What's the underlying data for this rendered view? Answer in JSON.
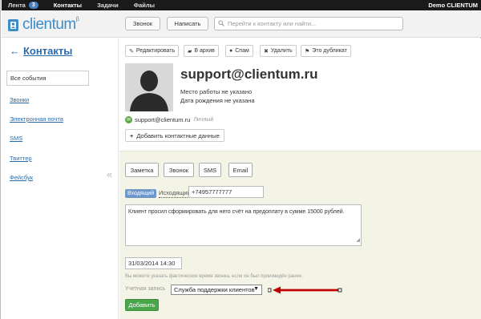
{
  "topbar": {
    "nav": [
      {
        "label": "Лента",
        "badge": "3"
      },
      {
        "label": "Контакты"
      },
      {
        "label": "Задачи"
      },
      {
        "label": "Файлы"
      }
    ],
    "account": "Demo CLIENTUM"
  },
  "header": {
    "logo_text": "clientum",
    "logo_beta": "β",
    "call_button": "Звонок",
    "write_button": "Написать",
    "search_placeholder": "Перейти к контакту или найти..."
  },
  "sidebar": {
    "back_arrow": "←",
    "title": "Контакты",
    "all_events": "Все события",
    "links": [
      "Звонки",
      "Электронная почта",
      "SMS",
      "Твиттер",
      "Фейсбук"
    ]
  },
  "gutter": {
    "collapse": "«"
  },
  "toolbar": {
    "edit": "Редактировать",
    "archive": "В архив",
    "spam": "Спам",
    "delete": "Удалить",
    "duplicate": "Это дубликат"
  },
  "contact": {
    "name": "support@clientum.ru",
    "workplace": "Место работы не указано",
    "birthday": "Дата рождения не указана",
    "email": "support@clientum.ru",
    "email_type": "Личный",
    "add_contact_data": "Добавить контактные данные"
  },
  "activity": {
    "types": [
      "Заметка",
      "Звонок",
      "SMS",
      "Email"
    ],
    "direction_in": "Входящий",
    "direction_out": "Исходящий",
    "phone": "+74957777777",
    "note_text": "Клиент просил сформировать для него счёт на предоплату в сумме 15000 рублей.",
    "datetime": "31/03/2014 14:30",
    "hint": "Вы можете указать фактическое время звонка, если он был произведён ранее.",
    "account_label": "Учетная запись",
    "account_value": "Служба поддержки клиентов",
    "submit": "Добавить"
  },
  "colors": {
    "link": "#2a6aa8",
    "brand": "#3b8dc8",
    "submit_green": "#4aa64a",
    "panel_bg": "#f4f4e6",
    "arrow_red": "#c00000"
  }
}
